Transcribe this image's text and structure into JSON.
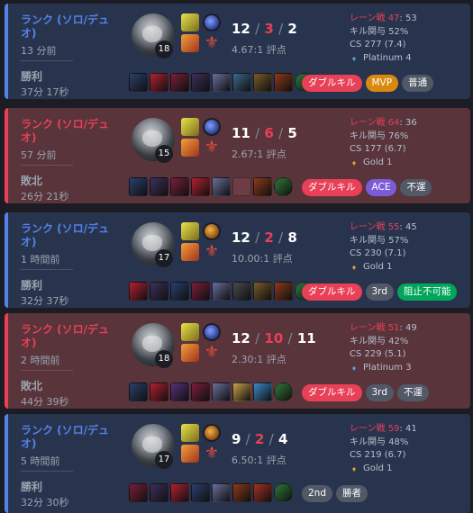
{
  "matches": [
    {
      "result_class": "win",
      "queue": "ランク (ソロ/デュオ)",
      "ago": "13 分前",
      "result": "勝利",
      "duration": "37分 17秒",
      "level": "18",
      "kda": {
        "k": "12",
        "d": "3",
        "a": "2",
        "ratio": "4.67:1 評点"
      },
      "stats": {
        "lane_label": "レーン戦",
        "pk_lead": "47",
        "pk_rest": ": 53",
        "kill_part": "キル関与 52%",
        "cs": "CS 277 (7.4)",
        "tier": "Platinum 4",
        "tier_color": "#4ea5d9"
      },
      "items": [
        "#2a3f6b",
        "#b3202e",
        "#7a1e3a",
        "#3d2f5c",
        "#6b6f9c",
        "#3a6a8a",
        "#7a5a2a",
        "#8c3a1a",
        "#2f7a3a"
      ],
      "badges": [
        {
          "label": "ダブルキル",
          "color": "red"
        },
        {
          "label": "MVP",
          "color": "gold"
        },
        {
          "label": "普通",
          "color": "gray"
        }
      ]
    },
    {
      "result_class": "loss",
      "queue": "ランク (ソロ/デュオ)",
      "ago": "57 分前",
      "result": "敗北",
      "duration": "26分 21秒",
      "level": "15",
      "kda": {
        "k": "11",
        "d": "6",
        "a": "5",
        "ratio": "2.67:1 評点"
      },
      "stats": {
        "lane_label": "レーン戦",
        "pk_lead": "64",
        "pk_rest": ": 36",
        "kill_part": "キル関与 76%",
        "cs": "CS 177 (6.7)",
        "tier": "Gold 1",
        "tier_color": "#d4a447"
      },
      "items": [
        "#2a3f6b",
        "#3d2f5c",
        "#7a1e3a",
        "#b3202e",
        "#6b6f9c",
        "",
        "#8c3a1a",
        "#2f7a3a"
      ],
      "badges": [
        {
          "label": "ダブルキル",
          "color": "red"
        },
        {
          "label": "ACE",
          "color": "purple"
        },
        {
          "label": "不運",
          "color": "gray"
        }
      ]
    },
    {
      "result_class": "win",
      "queue": "ランク (ソロ/デュオ)",
      "ago": "1 時間前",
      "result": "勝利",
      "duration": "32分 37秒",
      "level": "17",
      "kda": {
        "k": "12",
        "d": "2",
        "a": "8",
        "ratio": "10.00:1 評点"
      },
      "stats": {
        "lane_label": "レーン戦",
        "pk_lead": "55",
        "pk_rest": ": 45",
        "kill_part": "キル関与 57%",
        "cs": "CS 230 (7.1)",
        "tier": "Gold 1",
        "tier_color": "#d4a447"
      },
      "items": [
        "#b3202e",
        "#3d2f5c",
        "#2a3f6b",
        "#7a1e3a",
        "#6b6f9c",
        "#4a4a4a",
        "#7a5a2a",
        "#8c3a1a",
        "#2f7a3a"
      ],
      "badges": [
        {
          "label": "ダブルキル",
          "color": "red"
        },
        {
          "label": "3rd",
          "color": "gray"
        },
        {
          "label": "阻止不可能",
          "color": "green"
        }
      ]
    },
    {
      "result_class": "loss",
      "queue": "ランク (ソロ/デュオ)",
      "ago": "2 時間前",
      "result": "敗北",
      "duration": "44分 39秒",
      "level": "18",
      "kda": {
        "k": "12",
        "d": "10",
        "a": "11",
        "ratio": "2.30:1 評点"
      },
      "stats": {
        "lane_label": "レーン戦",
        "pk_lead": "51",
        "pk_rest": ": 49",
        "kill_part": "キル関与 42%",
        "cs": "CS 229 (5.1)",
        "tier": "Platinum 3",
        "tier_color": "#4ea5d9"
      },
      "items": [
        "#2a3f6b",
        "#b3202e",
        "#5a2f7a",
        "#7a1e3a",
        "#6b6f9c",
        "#c9a24a",
        "#3a8ac9",
        "#2f7a3a"
      ],
      "badges": [
        {
          "label": "ダブルキル",
          "color": "red"
        },
        {
          "label": "3rd",
          "color": "gray"
        },
        {
          "label": "不運",
          "color": "gray"
        }
      ]
    },
    {
      "result_class": "win",
      "queue": "ランク (ソロ/デュオ)",
      "ago": "5 時間前",
      "result": "勝利",
      "duration": "32分 30秒",
      "level": "17",
      "kda": {
        "k": "9",
        "d": "2",
        "a": "4",
        "ratio": "6.50:1 評点"
      },
      "stats": {
        "lane_label": "レーン戦",
        "pk_lead": "59",
        "pk_rest": ": 41",
        "kill_part": "キル関与 48%",
        "cs": "CS 219 (6.7)",
        "tier": "Gold 1",
        "tier_color": "#d4a447"
      },
      "items": [
        "#7a1e3a",
        "#3d2f5c",
        "#b3202e",
        "#2a3f6b",
        "#6b6f9c",
        "#8c3a1a",
        "#a33020",
        "#2f7a3a"
      ],
      "badges": [
        {
          "label": "2nd",
          "color": "gray"
        },
        {
          "label": "勝者",
          "color": "gray"
        }
      ]
    }
  ]
}
